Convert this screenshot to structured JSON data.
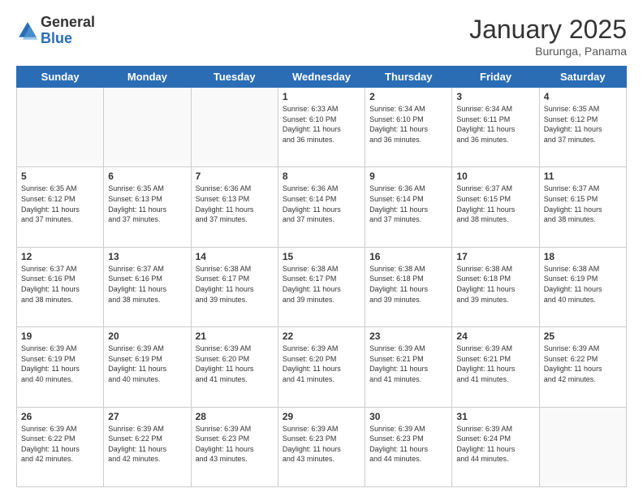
{
  "logo": {
    "general": "General",
    "blue": "Blue"
  },
  "header": {
    "month": "January 2025",
    "location": "Burunga, Panama"
  },
  "weekdays": [
    "Sunday",
    "Monday",
    "Tuesday",
    "Wednesday",
    "Thursday",
    "Friday",
    "Saturday"
  ],
  "weeks": [
    [
      {
        "day": "",
        "info": ""
      },
      {
        "day": "",
        "info": ""
      },
      {
        "day": "",
        "info": ""
      },
      {
        "day": "1",
        "info": "Sunrise: 6:33 AM\nSunset: 6:10 PM\nDaylight: 11 hours\nand 36 minutes."
      },
      {
        "day": "2",
        "info": "Sunrise: 6:34 AM\nSunset: 6:10 PM\nDaylight: 11 hours\nand 36 minutes."
      },
      {
        "day": "3",
        "info": "Sunrise: 6:34 AM\nSunset: 6:11 PM\nDaylight: 11 hours\nand 36 minutes."
      },
      {
        "day": "4",
        "info": "Sunrise: 6:35 AM\nSunset: 6:12 PM\nDaylight: 11 hours\nand 37 minutes."
      }
    ],
    [
      {
        "day": "5",
        "info": "Sunrise: 6:35 AM\nSunset: 6:12 PM\nDaylight: 11 hours\nand 37 minutes."
      },
      {
        "day": "6",
        "info": "Sunrise: 6:35 AM\nSunset: 6:13 PM\nDaylight: 11 hours\nand 37 minutes."
      },
      {
        "day": "7",
        "info": "Sunrise: 6:36 AM\nSunset: 6:13 PM\nDaylight: 11 hours\nand 37 minutes."
      },
      {
        "day": "8",
        "info": "Sunrise: 6:36 AM\nSunset: 6:14 PM\nDaylight: 11 hours\nand 37 minutes."
      },
      {
        "day": "9",
        "info": "Sunrise: 6:36 AM\nSunset: 6:14 PM\nDaylight: 11 hours\nand 37 minutes."
      },
      {
        "day": "10",
        "info": "Sunrise: 6:37 AM\nSunset: 6:15 PM\nDaylight: 11 hours\nand 38 minutes."
      },
      {
        "day": "11",
        "info": "Sunrise: 6:37 AM\nSunset: 6:15 PM\nDaylight: 11 hours\nand 38 minutes."
      }
    ],
    [
      {
        "day": "12",
        "info": "Sunrise: 6:37 AM\nSunset: 6:16 PM\nDaylight: 11 hours\nand 38 minutes."
      },
      {
        "day": "13",
        "info": "Sunrise: 6:37 AM\nSunset: 6:16 PM\nDaylight: 11 hours\nand 38 minutes."
      },
      {
        "day": "14",
        "info": "Sunrise: 6:38 AM\nSunset: 6:17 PM\nDaylight: 11 hours\nand 39 minutes."
      },
      {
        "day": "15",
        "info": "Sunrise: 6:38 AM\nSunset: 6:17 PM\nDaylight: 11 hours\nand 39 minutes."
      },
      {
        "day": "16",
        "info": "Sunrise: 6:38 AM\nSunset: 6:18 PM\nDaylight: 11 hours\nand 39 minutes."
      },
      {
        "day": "17",
        "info": "Sunrise: 6:38 AM\nSunset: 6:18 PM\nDaylight: 11 hours\nand 39 minutes."
      },
      {
        "day": "18",
        "info": "Sunrise: 6:38 AM\nSunset: 6:19 PM\nDaylight: 11 hours\nand 40 minutes."
      }
    ],
    [
      {
        "day": "19",
        "info": "Sunrise: 6:39 AM\nSunset: 6:19 PM\nDaylight: 11 hours\nand 40 minutes."
      },
      {
        "day": "20",
        "info": "Sunrise: 6:39 AM\nSunset: 6:19 PM\nDaylight: 11 hours\nand 40 minutes."
      },
      {
        "day": "21",
        "info": "Sunrise: 6:39 AM\nSunset: 6:20 PM\nDaylight: 11 hours\nand 41 minutes."
      },
      {
        "day": "22",
        "info": "Sunrise: 6:39 AM\nSunset: 6:20 PM\nDaylight: 11 hours\nand 41 minutes."
      },
      {
        "day": "23",
        "info": "Sunrise: 6:39 AM\nSunset: 6:21 PM\nDaylight: 11 hours\nand 41 minutes."
      },
      {
        "day": "24",
        "info": "Sunrise: 6:39 AM\nSunset: 6:21 PM\nDaylight: 11 hours\nand 41 minutes."
      },
      {
        "day": "25",
        "info": "Sunrise: 6:39 AM\nSunset: 6:22 PM\nDaylight: 11 hours\nand 42 minutes."
      }
    ],
    [
      {
        "day": "26",
        "info": "Sunrise: 6:39 AM\nSunset: 6:22 PM\nDaylight: 11 hours\nand 42 minutes."
      },
      {
        "day": "27",
        "info": "Sunrise: 6:39 AM\nSunset: 6:22 PM\nDaylight: 11 hours\nand 42 minutes."
      },
      {
        "day": "28",
        "info": "Sunrise: 6:39 AM\nSunset: 6:23 PM\nDaylight: 11 hours\nand 43 minutes."
      },
      {
        "day": "29",
        "info": "Sunrise: 6:39 AM\nSunset: 6:23 PM\nDaylight: 11 hours\nand 43 minutes."
      },
      {
        "day": "30",
        "info": "Sunrise: 6:39 AM\nSunset: 6:23 PM\nDaylight: 11 hours\nand 44 minutes."
      },
      {
        "day": "31",
        "info": "Sunrise: 6:39 AM\nSunset: 6:24 PM\nDaylight: 11 hours\nand 44 minutes."
      },
      {
        "day": "",
        "info": ""
      }
    ]
  ]
}
